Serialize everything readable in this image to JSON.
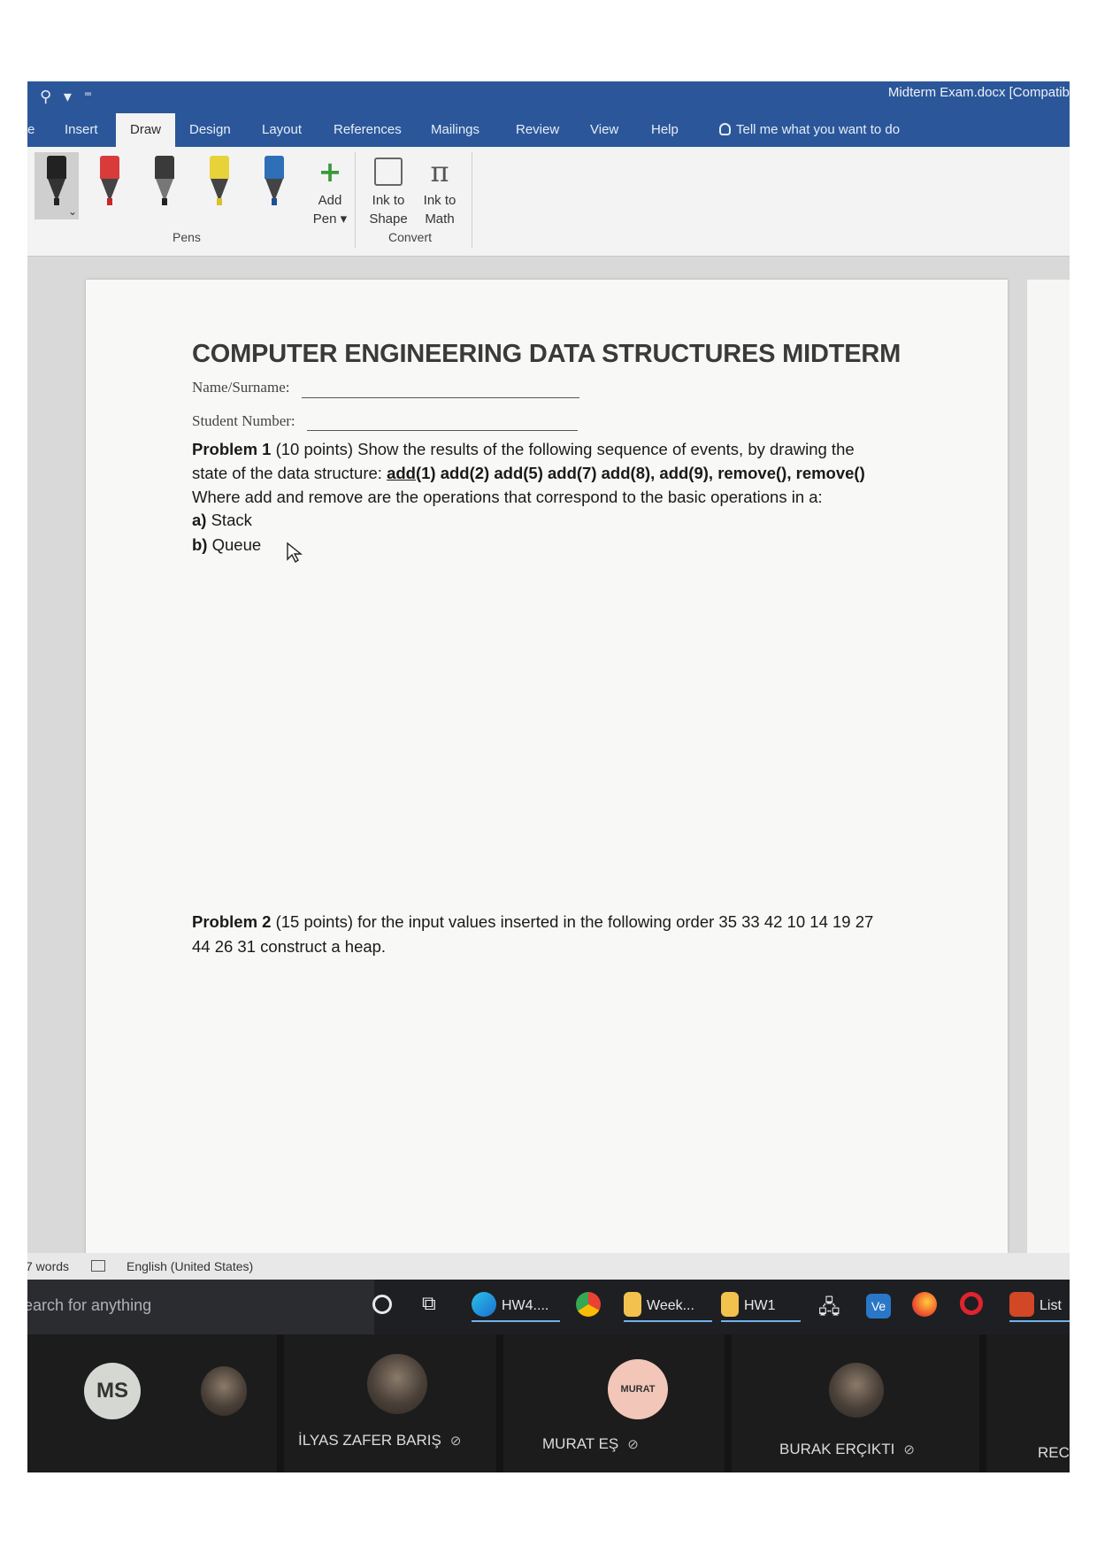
{
  "titlebar": {
    "quick_access": [
      "⚲",
      "▾",
      "⁼"
    ],
    "doc_title": "Midterm Exam.docx [Compatib"
  },
  "tabs": [
    "e",
    "Insert",
    "Draw",
    "Design",
    "Layout",
    "References",
    "Mailings",
    "Review",
    "View",
    "Help"
  ],
  "active_tab": "Draw",
  "tell_me": "Tell me what you want to do",
  "ribbon": {
    "pens_group_label": "Pens",
    "pen_colors": [
      "#222222",
      "#d93b3b",
      "#3a3a3a",
      "#e8d23a",
      "#2e6fb7"
    ],
    "add_pen": {
      "line1": "Add",
      "line2": "Pen ▾"
    },
    "ink_to_shape": {
      "line1": "Ink to",
      "line2": "Shape"
    },
    "ink_to_math": {
      "line1": "Ink to",
      "line2": "Math",
      "icon": "π"
    },
    "convert_group_label": "Convert",
    "dropdown_glyph": "⌄"
  },
  "document": {
    "heading": "COMPUTER ENGINEERING DATA STRUCTURES MIDTERM",
    "name_label": "Name/Surname:",
    "student_label": "Student Number:",
    "p1_title": "Problem 1",
    "p1_text1": "(10 points) Show the results of the following sequence of events, by drawing the",
    "p1_text2": "state of the data structure:",
    "p1_ops_add1": "add",
    "p1_ops_rest": "(1) add(2) add(5) add(7) add(8), add(9), remove(), remove()",
    "p1_text3": "Where add and remove are the operations that correspond to the basic operations in a:",
    "p1_a_label": "a)",
    "p1_a_text": "Stack",
    "p1_b_label": "b)",
    "p1_b_text": "Queue",
    "p2_title": "Problem 2",
    "p2_text1": "(15 points) for the input values inserted in the following order 35 33 42 10 14 19 27",
    "p2_text2": "44 26 31 construct a heap."
  },
  "statusbar": {
    "words": "7 words",
    "language": "English (United States)"
  },
  "taskbar": {
    "search_placeholder": "earch for anything",
    "items": [
      {
        "label": "",
        "icon": "cortana-circle"
      },
      {
        "label": "",
        "icon": "task-view"
      },
      {
        "label": "HW4....",
        "icon": "edge"
      },
      {
        "label": "",
        "icon": "chrome"
      },
      {
        "label": "Week...",
        "icon": "file-explorer"
      },
      {
        "label": "HW1",
        "icon": "file-explorer"
      },
      {
        "label": "",
        "icon": "network"
      },
      {
        "label": "",
        "icon": "vscode"
      },
      {
        "label": "",
        "icon": "firefox"
      },
      {
        "label": "",
        "icon": "opera"
      },
      {
        "label": "List",
        "icon": "powerpoint"
      }
    ],
    "vs_label": "Ve"
  },
  "call": {
    "ms_initials": "MS",
    "participants": [
      {
        "name": "İLYAS ZAFER BARIŞ"
      },
      {
        "name": "MURAT EŞ",
        "avatar_text": "MURAT"
      },
      {
        "name": "BURAK ERÇIKTI"
      },
      {
        "name": "RECEP"
      }
    ],
    "mic_off_glyph": "🎙"
  }
}
